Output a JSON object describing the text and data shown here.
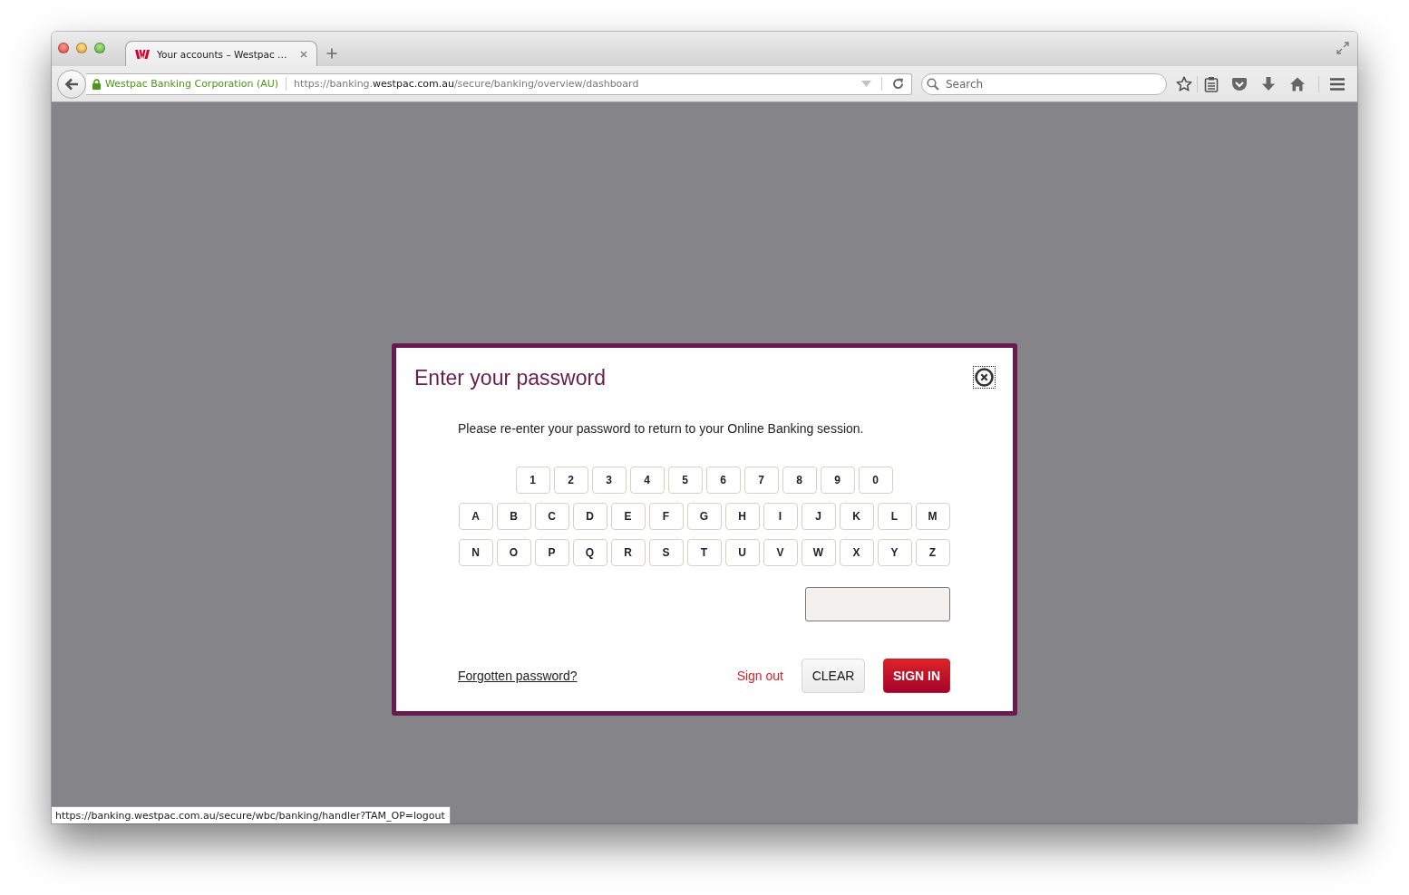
{
  "window": {
    "tabs": [
      {
        "title": "Your accounts – Westpac …",
        "selected": true
      }
    ]
  },
  "toolbar": {
    "site_identity": "Westpac Banking Corporation (AU)",
    "url": "https://banking.**westpac.com.au**/secure/banking/overview/dashboard",
    "search": {
      "placeholder": "Search"
    }
  },
  "dialog": {
    "title": "Enter your password",
    "message": "Please re-enter your password to return to your Online Banking session.",
    "keypad": [
      [
        "1",
        "2",
        "3",
        "4",
        "5",
        "6",
        "7",
        "8",
        "9",
        "0"
      ],
      [
        "A",
        "B",
        "C",
        "D",
        "E",
        "F",
        "G",
        "H",
        "I",
        "J",
        "K",
        "L",
        "M"
      ],
      [
        "N",
        "O",
        "P",
        "Q",
        "R",
        "S",
        "T",
        "U",
        "V",
        "W",
        "X",
        "Y",
        "Z"
      ]
    ],
    "forgot_link": "Forgotten password?",
    "sign_out_link": "Sign out",
    "buttons": [
      {
        "label": "CLEAR",
        "kind": "secondary"
      },
      {
        "label": "SIGN IN",
        "kind": "primary"
      }
    ]
  },
  "status_bar": {
    "link_preview": "https://banking.westpac.com.au/secure/wbc/banking/handler?TAM_OP=logout"
  }
}
